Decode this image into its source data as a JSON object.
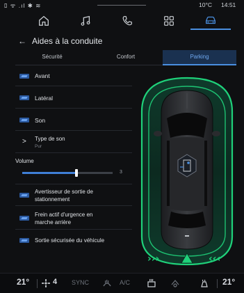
{
  "status_bar": {
    "left_icons": "ﾛ ᯤ .ıl ✱ ≋",
    "temperature": "10°C",
    "time": "14:51"
  },
  "top_nav": {
    "items": [
      {
        "icon": "home-icon"
      },
      {
        "icon": "music-icon"
      },
      {
        "icon": "phone-icon"
      },
      {
        "icon": "apps-icon"
      },
      {
        "icon": "car-icon",
        "active": true
      }
    ]
  },
  "header": {
    "back_icon": "←",
    "title": "Aides à la conduite"
  },
  "tabs": {
    "items": [
      {
        "label": "Sécurité"
      },
      {
        "label": "Confort"
      },
      {
        "label": "Parking",
        "active": true
      }
    ]
  },
  "settings": {
    "avant": {
      "label": "Avant",
      "enabled": true
    },
    "lateral": {
      "label": "Latéral",
      "enabled": true
    },
    "son": {
      "label": "Son",
      "enabled": true
    },
    "type_son": {
      "chevron": ">",
      "label": "Type de son",
      "value": "Pur"
    },
    "volume": {
      "label": "Volume",
      "level": 0.6,
      "value": "3"
    },
    "avertisseur": {
      "label_line1": "Avertisseur de sortie de",
      "label_line2": "stationnement",
      "enabled": true
    },
    "frein": {
      "label_line1": "Frein actif d'urgence en",
      "label_line2": "marche arrière",
      "enabled": true
    },
    "sortie": {
      "label": "Sortie sécurisée du véhicule",
      "enabled": true
    }
  },
  "parking": {
    "zone_color": "#1fd17a",
    "left_arrows": "›››",
    "right_arrows": "‹‹‹"
  },
  "bottom_bar": {
    "temp_left": "21°",
    "fan": "4",
    "sync": "SYNC",
    "ac": "A/C",
    "temp_right": "21°"
  },
  "colors": {
    "accent": "#4a8fe0",
    "parking_zone": "#1fd17a"
  }
}
